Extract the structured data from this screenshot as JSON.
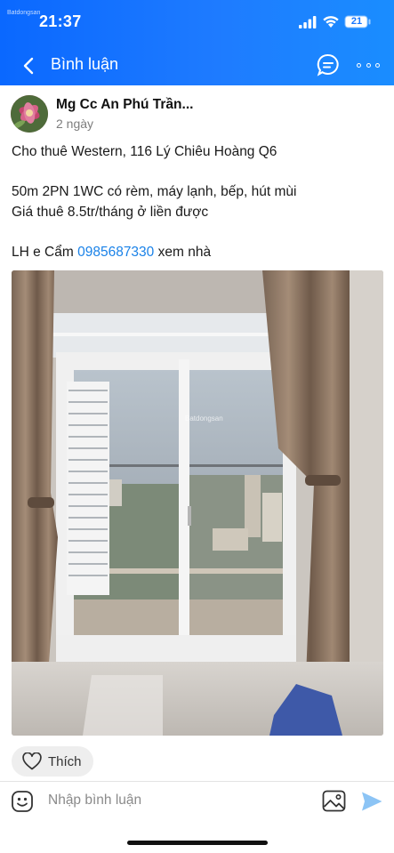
{
  "status_bar": {
    "time": "21:37",
    "battery": "21",
    "watermark": "Batdongsan"
  },
  "header": {
    "title": "Bình luận",
    "back_icon": "chevron-left-icon",
    "chat_icon": "chat-bubble-icon",
    "more_icon": "more-horizontal-icon"
  },
  "post": {
    "author": "Mg Cc An Phú Trần...",
    "time": "2 ngày",
    "lines": [
      "Cho thuê Western, 116 Lý Chiêu Hoàng Q6",
      "",
      "50m 2PN 1WC có rèm, máy lạnh, bếp, hút mùi",
      "Giá thuê 8.5tr/tháng ở liền được",
      ""
    ],
    "contact_prefix": "LH e Cẩm ",
    "contact_phone": "0985687330",
    "contact_suffix": " xem nhà",
    "photo_watermark": "Batdongsan"
  },
  "actions": {
    "like_label": "Thích"
  },
  "comment": {
    "placeholder": "Nhập bình luận"
  },
  "colors": {
    "header_blue": "#1476ff",
    "link_blue": "#1a82e8",
    "send_blue": "#8cc4f5"
  }
}
